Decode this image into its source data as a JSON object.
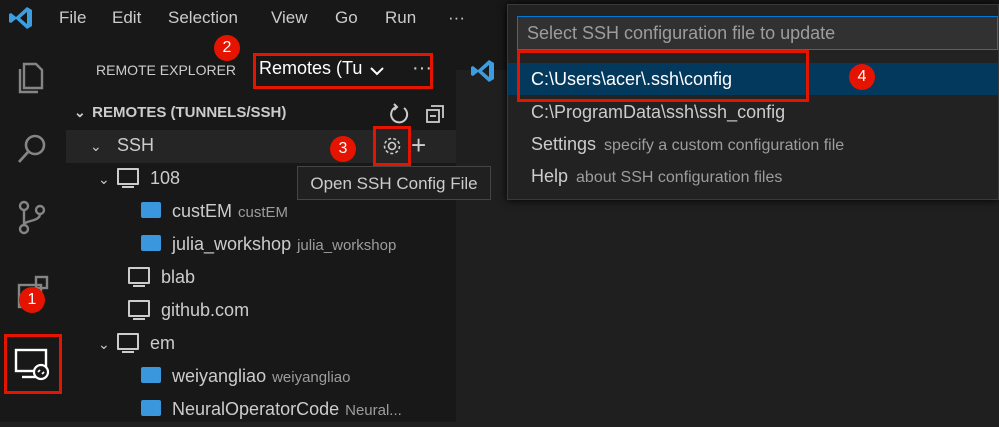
{
  "menu": [
    "File",
    "Edit",
    "Selection",
    "View",
    "Go",
    "Run",
    "···"
  ],
  "sidebar": {
    "title": "REMOTE EXPLORER",
    "dropdown": "Remotes (Tu",
    "section": "REMOTES (TUNNELS/SSH)",
    "ssh_label": "SSH",
    "tree": [
      {
        "label": "108",
        "kind": "host",
        "expanded": true
      },
      {
        "label": "custEM",
        "desc": "custEM",
        "kind": "folder"
      },
      {
        "label": "julia_workshop",
        "desc": "julia_workshop",
        "kind": "folder"
      },
      {
        "label": "blab",
        "kind": "host"
      },
      {
        "label": "github.com",
        "kind": "host"
      },
      {
        "label": "em",
        "kind": "host",
        "expanded": true
      },
      {
        "label": "weiyangliao",
        "desc": "weiyangliao",
        "kind": "folder"
      },
      {
        "label": "NeuralOperatorCode",
        "desc": "Neural...",
        "kind": "folder"
      }
    ]
  },
  "tooltip": "Open SSH Config File",
  "quickpick": {
    "placeholder": "Select SSH configuration file to update",
    "items": [
      {
        "label": "C:\\Users\\acer\\.ssh\\config",
        "desc": "",
        "selected": true
      },
      {
        "label": "C:\\ProgramData\\ssh\\ssh_config",
        "desc": "",
        "selected": false
      },
      {
        "label": "Settings",
        "desc": "specify a custom configuration file",
        "selected": false
      },
      {
        "label": "Help",
        "desc": "about SSH configuration files",
        "selected": false
      }
    ]
  },
  "badges": [
    "1",
    "2",
    "3",
    "4"
  ],
  "colors": {
    "accent": "#0078d4",
    "annotation": "#e51400",
    "selection": "#04395e"
  }
}
